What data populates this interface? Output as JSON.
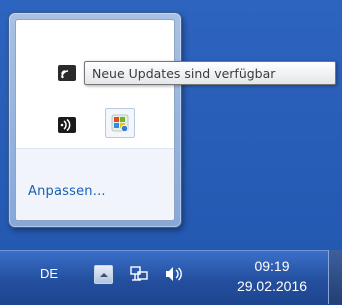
{
  "flyout": {
    "customize_link": "Anpassen...",
    "icons": [
      "wifi-signal-icon",
      "generic-app-icon",
      "audio-device-icon",
      "windows-update-icon"
    ]
  },
  "tooltip": {
    "text": "Neue Updates sind verfügbar"
  },
  "taskbar": {
    "language": "DE",
    "clock_time": "09:19",
    "clock_date": "29.02.2016",
    "icons": [
      "show-hidden-icons-icon",
      "network-icon",
      "volume-icon"
    ]
  },
  "colors": {
    "desktop": "#2a5fb9",
    "link": "#1a5fb4"
  }
}
